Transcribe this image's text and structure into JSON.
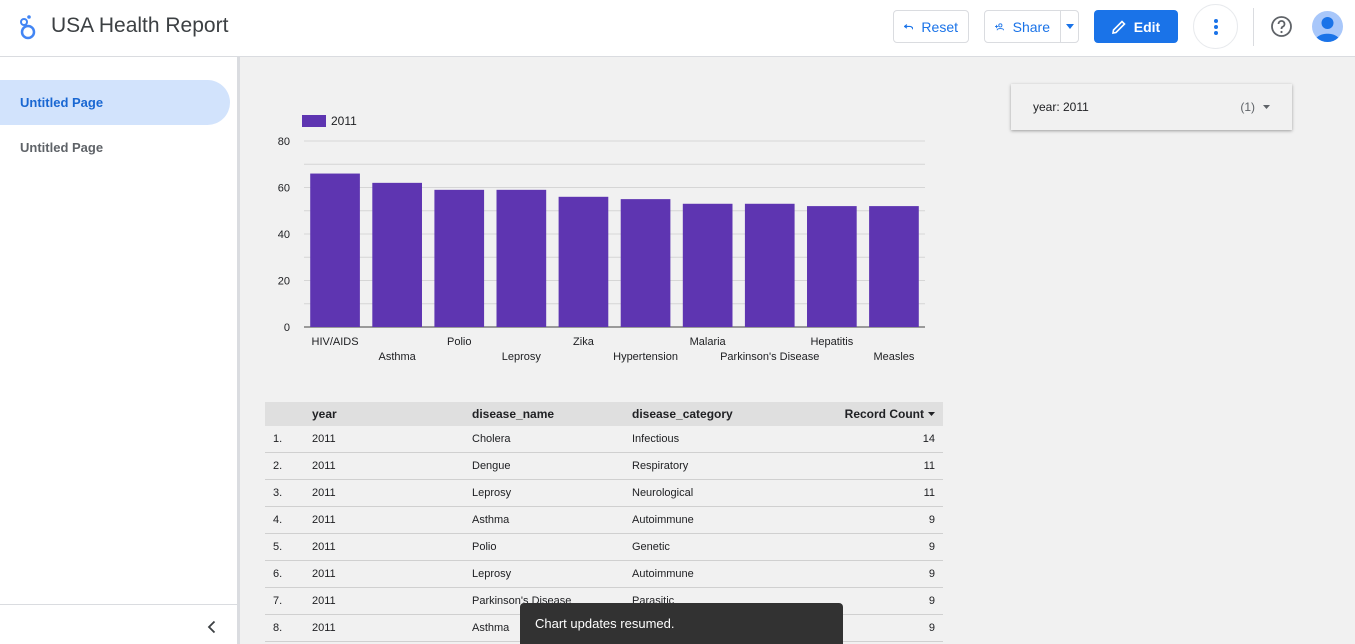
{
  "header": {
    "title": "USA Health Report",
    "reset_label": "Reset",
    "share_label": "Share",
    "edit_label": "Edit"
  },
  "sidebar": {
    "items": [
      {
        "label": "Untitled Page",
        "active": true
      },
      {
        "label": "Untitled Page",
        "active": false
      }
    ]
  },
  "filter": {
    "field": "year",
    "value": ": 2011",
    "count": "(1)"
  },
  "chart_data": {
    "type": "bar",
    "legend": [
      "2011"
    ],
    "color": "#5e35b1",
    "categories": [
      "HIV/AIDS",
      "Asthma",
      "Polio",
      "Leprosy",
      "Zika",
      "Hypertension",
      "Malaria",
      "Parkinson's Disease",
      "Hepatitis",
      "Measles"
    ],
    "series": [
      {
        "name": "2011",
        "values": [
          66,
          62,
          59,
          59,
          56,
          55,
          53,
          53,
          52,
          52
        ]
      }
    ],
    "yticks": [
      "0",
      "20",
      "40",
      "60",
      "80"
    ],
    "ylim": [
      0,
      80
    ],
    "grid": true,
    "legend_position": "top-left"
  },
  "table": {
    "headers": [
      "year",
      "disease_name",
      "disease_category",
      "Record Count"
    ],
    "rows": [
      {
        "idx": "1.",
        "year": "2011",
        "name": "Cholera",
        "category": "Infectious",
        "count": "14"
      },
      {
        "idx": "2.",
        "year": "2011",
        "name": "Dengue",
        "category": "Respiratory",
        "count": "11"
      },
      {
        "idx": "3.",
        "year": "2011",
        "name": "Leprosy",
        "category": "Neurological",
        "count": "11"
      },
      {
        "idx": "4.",
        "year": "2011",
        "name": "Asthma",
        "category": "Autoimmune",
        "count": "9"
      },
      {
        "idx": "5.",
        "year": "2011",
        "name": "Polio",
        "category": "Genetic",
        "count": "9"
      },
      {
        "idx": "6.",
        "year": "2011",
        "name": "Leprosy",
        "category": "Autoimmune",
        "count": "9"
      },
      {
        "idx": "7.",
        "year": "2011",
        "name": "Parkinson's Disease",
        "category": "Parasitic",
        "count": "9"
      },
      {
        "idx": "8.",
        "year": "2011",
        "name": "Asthma",
        "category": "",
        "count": "9"
      }
    ]
  },
  "toast": {
    "message": "Chart updates resumed."
  },
  "colors": {
    "accent": "#1a73e8",
    "bar": "#5e35b1",
    "active_nav_bg": "#d2e3fc"
  }
}
